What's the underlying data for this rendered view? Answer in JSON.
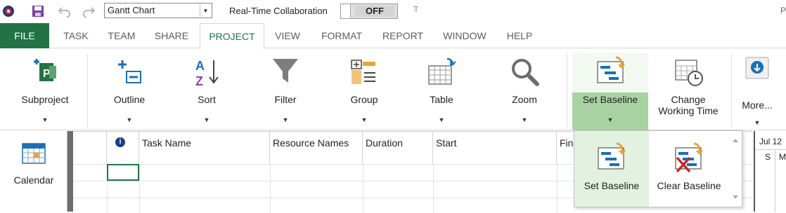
{
  "quick_access": {
    "view_selector": {
      "value": "Gantt Chart"
    },
    "collab_label": "Real-Time Collaboration",
    "collab_toggle": "OFF",
    "more_glyph": "⫪",
    "app_edge_text": "P"
  },
  "tabs": [
    {
      "label": "FILE"
    },
    {
      "label": "TASK"
    },
    {
      "label": "TEAM"
    },
    {
      "label": "SHARE"
    },
    {
      "label": "PROJECT"
    },
    {
      "label": "VIEW"
    },
    {
      "label": "FORMAT"
    },
    {
      "label": "REPORT"
    },
    {
      "label": "WINDOW"
    },
    {
      "label": "HELP"
    }
  ],
  "ribbon": {
    "subproject": "Subproject",
    "outline": "Outline",
    "sort": "Sort",
    "filter": "Filter",
    "group": "Group",
    "table": "Table",
    "zoom": "Zoom",
    "set_baseline": "Set Baseline",
    "change_working_time_1": "Change",
    "change_working_time_2": "Working Time",
    "more": "More...",
    "dropdown_glyph": "▼"
  },
  "left_panel": {
    "calendar": "Calendar"
  },
  "grid": {
    "info_glyph": "i",
    "columns": [
      "Task Name",
      "Resource Names",
      "Duration",
      "Start",
      "Fin"
    ]
  },
  "timeline": {
    "week": "Jul 12",
    "day_s": "S",
    "day_m": "M"
  },
  "baseline_menu": {
    "set_baseline": "Set Baseline",
    "clear_baseline": "Clear Baseline"
  },
  "colors": {
    "brand_green": "#217346",
    "active_tab_text": "#217346",
    "baseline_highlight": "#a9d2a2",
    "icon_blue": "#1a6fb5",
    "icon_orange": "#e8a33a"
  }
}
